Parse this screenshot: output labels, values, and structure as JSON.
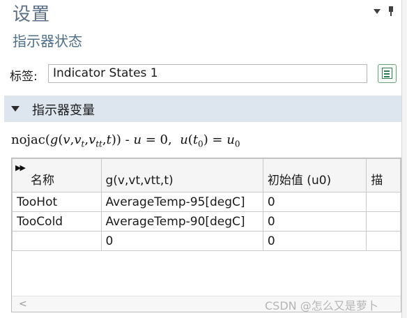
{
  "header": {
    "title": "设置",
    "subtitle": "指示器状态"
  },
  "label_field": {
    "label": "标签:",
    "value": "Indicator States 1"
  },
  "section": {
    "title": "指示器变量"
  },
  "equation": {
    "text_prefix": "nojac",
    "latex_note": "g(v,v_t,v_tt,t) - u = 0, u(t_0) = u_0"
  },
  "table": {
    "columns": [
      "名称",
      "g(v,vt,vtt,t)",
      "初始值 (u0)",
      "描"
    ],
    "rows": [
      [
        "TooHot",
        "AverageTemp-95[degC]",
        "0",
        ""
      ],
      [
        "TooCold",
        "AverageTemp-90[degC]",
        "0",
        ""
      ],
      [
        "",
        "0",
        "0",
        ""
      ]
    ]
  },
  "watermark": "CSDN @怎么又是萝卜",
  "colors": {
    "title": "#5a6f86",
    "section_bg": "#dde6ef",
    "icon_green": "#2e7d4f"
  }
}
